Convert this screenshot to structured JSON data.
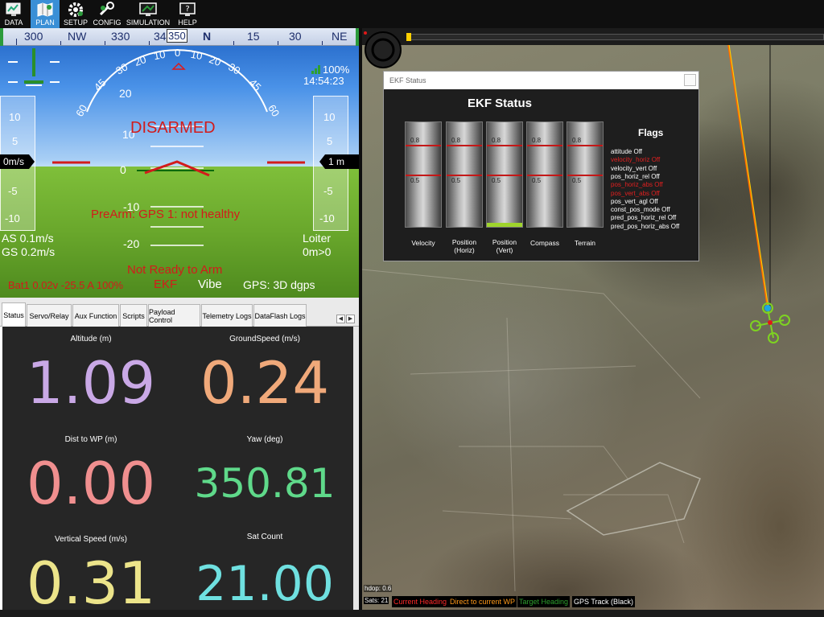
{
  "menu": {
    "items": [
      {
        "label": "DATA",
        "icon": "data-icon"
      },
      {
        "label": "PLAN",
        "icon": "plan-icon"
      },
      {
        "label": "SETUP",
        "icon": "setup-icon"
      },
      {
        "label": "CONFIG",
        "icon": "config-icon"
      },
      {
        "label": "SIMULATION",
        "icon": "simulation-icon"
      },
      {
        "label": "HELP",
        "icon": "help-icon"
      }
    ],
    "active": "PLAN"
  },
  "hud": {
    "compass": [
      "300",
      "NW",
      "330",
      "34",
      "350",
      "N",
      "15",
      "30",
      "NE"
    ],
    "pitch_left": [
      "60",
      "45",
      "30",
      "20",
      "10",
      "0"
    ],
    "pitch_right": [
      "10",
      "20",
      "30",
      "45",
      "60"
    ],
    "pitch_ladder": [
      "20",
      "10",
      "0",
      "-10",
      "-20"
    ],
    "battery_percent": "100%",
    "time": "14:54:23",
    "speed_tape": [
      "10",
      "5",
      "0",
      "-5",
      "-10"
    ],
    "speed_value": "0m/s",
    "alt_tape": [
      "10",
      "5",
      "-5",
      "-10"
    ],
    "alt_value": "1 m",
    "disarmed": "DISARMED",
    "prearm": "PreArm: GPS 1: not healthy",
    "airspeed": "AS 0.1m/s",
    "groundspeed": "GS 0.2m/s",
    "mode": "Loiter",
    "mode_sub": "0m>0",
    "not_ready": "Not Ready to Arm",
    "battery": "Bat1 0.02v -25.5 A 100%",
    "ekf": "EKF",
    "vibe": "Vibe",
    "gps": "GPS: 3D dgps",
    "colors": {
      "alert": "#d21b1b",
      "accent": "#3a8fd6"
    }
  },
  "tabs": {
    "items": [
      "Status",
      "Servo/Relay",
      "Aux Function",
      "Scripts",
      "Payload Control",
      "Telemetry Logs",
      "DataFlash Logs"
    ],
    "active": "Status"
  },
  "quick": [
    {
      "label": "Altitude (m)",
      "value": "1.09",
      "color": "#c9a8e6"
    },
    {
      "label": "GroundSpeed (m/s)",
      "value": "0.24",
      "color": "#f0a97a"
    },
    {
      "label": "Dist to WP (m)",
      "value": "0.00",
      "color": "#f08f8f"
    },
    {
      "label": "Yaw (deg)",
      "value": "350.81",
      "color": "#5fd98a"
    },
    {
      "label": "Vertical Speed (m/s)",
      "value": "0.31",
      "color": "#ece48a"
    },
    {
      "label": "Sat Count",
      "value": "21.00",
      "color": "#6fe0e0"
    }
  ],
  "ekf": {
    "window_title": "EKF Status",
    "heading": "EKF Status",
    "tick_high": "0.8",
    "tick_low": "0.5",
    "bars": [
      {
        "label": "Velocity",
        "value": 0.0
      },
      {
        "label": "Position\n(Horiz)",
        "value": 0.0
      },
      {
        "label": "Position\n(Vert)",
        "value": 0.04
      },
      {
        "label": "Compass",
        "value": 0.0
      },
      {
        "label": "Terrain",
        "value": 0.0
      }
    ],
    "flags_title": "Flags",
    "flags": [
      {
        "text": "attitude Off",
        "alert": false
      },
      {
        "text": "velocity_horiz Off",
        "alert": true
      },
      {
        "text": "velocity_vert Off",
        "alert": false
      },
      {
        "text": "pos_horiz_rel Off",
        "alert": false
      },
      {
        "text": "pos_horiz_abs Off",
        "alert": true
      },
      {
        "text": "pos_vert_abs Off",
        "alert": true
      },
      {
        "text": "pos_vert_agl Off",
        "alert": false
      },
      {
        "text": "const_pos_mode Off",
        "alert": false
      },
      {
        "text": "pred_pos_horiz_rel Off",
        "alert": false
      },
      {
        "text": "pred_pos_horiz_abs Off",
        "alert": false
      }
    ]
  },
  "map": {
    "hdop": "hdop: 0.6",
    "sats": "Sats: 21",
    "legend": [
      {
        "label": "Current Heading",
        "color": "#ff2a2a"
      },
      {
        "label": "Direct to current WP",
        "color": "#ff9a1a"
      },
      {
        "label": "Target Heading",
        "color": "#2ea02e"
      },
      {
        "label": "GPS Track (Black)",
        "color": "#ffffff"
      }
    ]
  }
}
